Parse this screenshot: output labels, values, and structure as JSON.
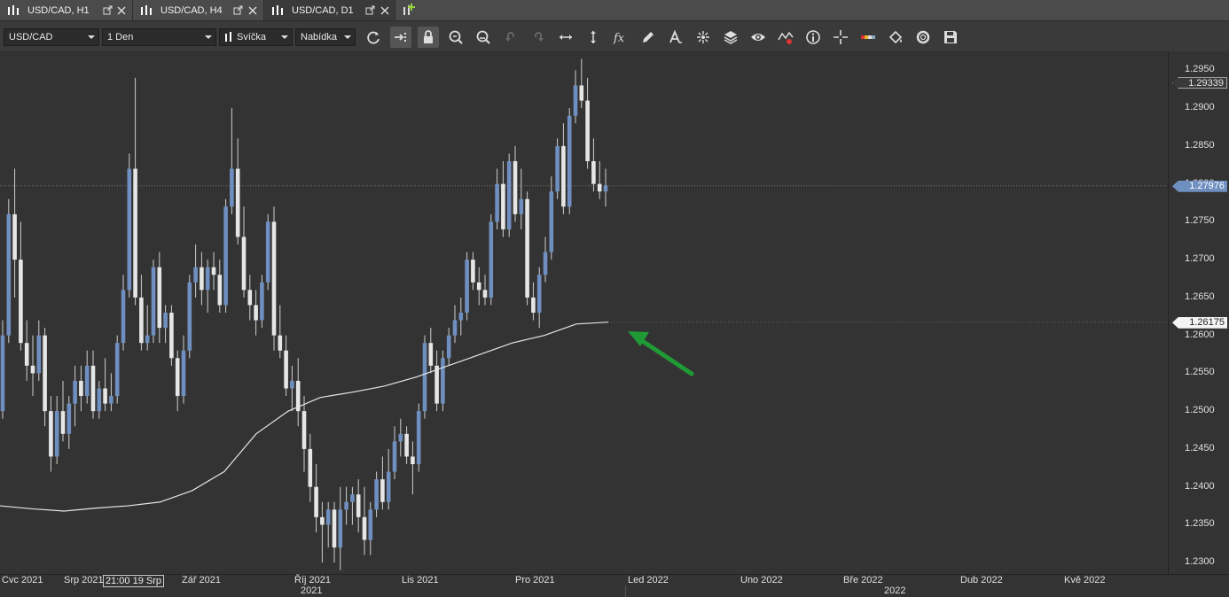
{
  "tabs": [
    {
      "label": "USD/CAD, H1",
      "active": false
    },
    {
      "label": "USD/CAD, H4",
      "active": false
    },
    {
      "label": "USD/CAD, D1",
      "active": true
    }
  ],
  "toolbar": {
    "symbol": "USD/CAD",
    "timeframe": "1 Den",
    "chart_type": "Svíčka",
    "price_side": "Nabídka",
    "tools": [
      "refresh-icon",
      "autoscroll-icon",
      "lock-icon",
      "zoom-in-icon",
      "zoom-out-icon",
      "undo-icon",
      "redo-icon",
      "horizontal-scale-icon",
      "vertical-scale-icon",
      "indicator-fx-icon",
      "pencil-icon",
      "text-icon",
      "objects-icon",
      "layers-icon",
      "eye-icon",
      "alerts-icon",
      "info-icon",
      "crosshair-icon",
      "color-icon",
      "paint-bucket-icon",
      "settings-icon",
      "save-icon"
    ]
  },
  "price_axis": {
    "ticks": [
      "1.2950",
      "1.2900",
      "1.2850",
      "1.2800",
      "1.2750",
      "1.2700",
      "1.2650",
      "1.2600",
      "1.2550",
      "1.2500",
      "1.2450",
      "1.2400",
      "1.2350",
      "1.2300"
    ],
    "labels": [
      {
        "value": "1.29339",
        "style": "outline"
      },
      {
        "value": "1.27976",
        "style": "blue"
      },
      {
        "value": "1.26175",
        "style": "white"
      }
    ]
  },
  "time_axis": {
    "months": [
      "Cvc 2021",
      "Srp 2021",
      "Zář 2021",
      "Říj 2021",
      "Lis 2021",
      "Pro 2021",
      "Led 2022",
      "Uno 2022",
      "Bře 2022",
      "Dub 2022",
      "Kvě 2022"
    ],
    "years": [
      "2021",
      "2022"
    ],
    "crosshair_time": "21:00 19 Srp"
  },
  "colors": {
    "background": "#333333",
    "bull": "#6f8fc0",
    "bear": "#e6e6e6",
    "ma": "#e6e6e6",
    "arrow": "#1f9a35"
  },
  "chart_data": {
    "type": "candlestick",
    "symbol": "USD/CAD",
    "timeframe": "D1",
    "ylim": [
      1.2285,
      1.2975
    ],
    "last_price": 1.27976,
    "marked_price": 1.29339,
    "ma_last": 1.26175,
    "candles": [
      [
        1.25,
        1.262,
        1.249,
        1.26
      ],
      [
        1.26,
        1.278,
        1.259,
        1.276
      ],
      [
        1.276,
        1.282,
        1.265,
        1.27
      ],
      [
        1.27,
        1.275,
        1.258,
        1.259
      ],
      [
        1.259,
        1.262,
        1.254,
        1.256
      ],
      [
        1.256,
        1.26,
        1.252,
        1.255
      ],
      [
        1.255,
        1.262,
        1.254,
        1.26
      ],
      [
        1.26,
        1.261,
        1.248,
        1.25
      ],
      [
        1.25,
        1.252,
        1.242,
        1.244
      ],
      [
        1.244,
        1.252,
        1.243,
        1.25
      ],
      [
        1.25,
        1.254,
        1.246,
        1.247
      ],
      [
        1.247,
        1.252,
        1.245,
        1.251
      ],
      [
        1.251,
        1.256,
        1.248,
        1.254
      ],
      [
        1.254,
        1.256,
        1.25,
        1.252
      ],
      [
        1.252,
        1.258,
        1.251,
        1.256
      ],
      [
        1.256,
        1.258,
        1.249,
        1.25
      ],
      [
        1.25,
        1.254,
        1.249,
        1.253
      ],
      [
        1.253,
        1.257,
        1.25,
        1.251
      ],
      [
        1.251,
        1.255,
        1.25,
        1.252
      ],
      [
        1.252,
        1.26,
        1.251,
        1.259
      ],
      [
        1.259,
        1.268,
        1.258,
        1.266
      ],
      [
        1.266,
        1.284,
        1.265,
        1.282
      ],
      [
        1.282,
        1.294,
        1.264,
        1.265
      ],
      [
        1.265,
        1.268,
        1.258,
        1.259
      ],
      [
        1.259,
        1.264,
        1.258,
        1.26
      ],
      [
        1.26,
        1.27,
        1.259,
        1.269
      ],
      [
        1.269,
        1.271,
        1.259,
        1.261
      ],
      [
        1.261,
        1.264,
        1.259,
        1.263
      ],
      [
        1.263,
        1.264,
        1.256,
        1.257
      ],
      [
        1.257,
        1.258,
        1.25,
        1.252
      ],
      [
        1.252,
        1.26,
        1.251,
        1.258
      ],
      [
        1.258,
        1.268,
        1.257,
        1.267
      ],
      [
        1.267,
        1.272,
        1.265,
        1.269
      ],
      [
        1.269,
        1.271,
        1.264,
        1.266
      ],
      [
        1.266,
        1.27,
        1.263,
        1.269
      ],
      [
        1.269,
        1.271,
        1.266,
        1.268
      ],
      [
        1.268,
        1.27,
        1.263,
        1.264
      ],
      [
        1.264,
        1.278,
        1.263,
        1.277
      ],
      [
        1.277,
        1.29,
        1.276,
        1.282
      ],
      [
        1.282,
        1.286,
        1.272,
        1.273
      ],
      [
        1.273,
        1.277,
        1.265,
        1.266
      ],
      [
        1.266,
        1.268,
        1.262,
        1.264
      ],
      [
        1.264,
        1.266,
        1.26,
        1.262
      ],
      [
        1.262,
        1.268,
        1.261,
        1.267
      ],
      [
        1.267,
        1.276,
        1.266,
        1.275
      ],
      [
        1.275,
        1.277,
        1.258,
        1.26
      ],
      [
        1.26,
        1.264,
        1.257,
        1.258
      ],
      [
        1.258,
        1.26,
        1.252,
        1.253
      ],
      [
        1.253,
        1.256,
        1.25,
        1.254
      ],
      [
        1.254,
        1.257,
        1.248,
        1.25
      ],
      [
        1.25,
        1.252,
        1.242,
        1.245
      ],
      [
        1.245,
        1.247,
        1.238,
        1.24
      ],
      [
        1.24,
        1.243,
        1.234,
        1.236
      ],
      [
        1.236,
        1.238,
        1.23,
        1.235
      ],
      [
        1.235,
        1.238,
        1.232,
        1.237
      ],
      [
        1.237,
        1.238,
        1.23,
        1.232
      ],
      [
        1.232,
        1.24,
        1.229,
        1.237
      ],
      [
        1.237,
        1.24,
        1.235,
        1.238
      ],
      [
        1.238,
        1.24,
        1.235,
        1.239
      ],
      [
        1.239,
        1.241,
        1.234,
        1.236
      ],
      [
        1.236,
        1.24,
        1.231,
        1.233
      ],
      [
        1.233,
        1.238,
        1.231,
        1.237
      ],
      [
        1.237,
        1.242,
        1.236,
        1.241
      ],
      [
        1.241,
        1.244,
        1.237,
        1.238
      ],
      [
        1.238,
        1.245,
        1.237,
        1.242
      ],
      [
        1.242,
        1.248,
        1.241,
        1.246
      ],
      [
        1.246,
        1.249,
        1.244,
        1.247
      ],
      [
        1.247,
        1.248,
        1.243,
        1.244
      ],
      [
        1.244,
        1.246,
        1.239,
        1.243
      ],
      [
        1.243,
        1.251,
        1.242,
        1.25
      ],
      [
        1.25,
        1.26,
        1.249,
        1.259
      ],
      [
        1.259,
        1.261,
        1.255,
        1.256
      ],
      [
        1.256,
        1.258,
        1.25,
        1.251
      ],
      [
        1.251,
        1.258,
        1.25,
        1.257
      ],
      [
        1.257,
        1.261,
        1.256,
        1.26
      ],
      [
        1.26,
        1.264,
        1.259,
        1.262
      ],
      [
        1.262,
        1.265,
        1.26,
        1.263
      ],
      [
        1.263,
        1.271,
        1.262,
        1.27
      ],
      [
        1.27,
        1.271,
        1.266,
        1.267
      ],
      [
        1.267,
        1.269,
        1.264,
        1.266
      ],
      [
        1.266,
        1.268,
        1.264,
        1.265
      ],
      [
        1.265,
        1.276,
        1.264,
        1.275
      ],
      [
        1.275,
        1.282,
        1.274,
        1.28
      ],
      [
        1.28,
        1.283,
        1.273,
        1.274
      ],
      [
        1.274,
        1.284,
        1.273,
        1.283
      ],
      [
        1.283,
        1.285,
        1.275,
        1.276
      ],
      [
        1.276,
        1.282,
        1.274,
        1.278
      ],
      [
        1.278,
        1.279,
        1.264,
        1.265
      ],
      [
        1.265,
        1.267,
        1.262,
        1.263
      ],
      [
        1.263,
        1.269,
        1.261,
        1.268
      ],
      [
        1.268,
        1.273,
        1.267,
        1.271
      ],
      [
        1.271,
        1.281,
        1.27,
        1.279
      ],
      [
        1.279,
        1.286,
        1.278,
        1.285
      ],
      [
        1.285,
        1.288,
        1.276,
        1.277
      ],
      [
        1.277,
        1.29,
        1.276,
        1.289
      ],
      [
        1.289,
        1.295,
        1.288,
        1.293
      ],
      [
        1.293,
        1.2965,
        1.29,
        1.291
      ],
      [
        1.291,
        1.294,
        1.282,
        1.283
      ],
      [
        1.283,
        1.286,
        1.279,
        1.28
      ],
      [
        1.28,
        1.283,
        1.278,
        1.279
      ],
      [
        1.279,
        1.282,
        1.277,
        1.2798
      ]
    ],
    "ma": [
      1.2375,
      1.2371,
      1.2368,
      1.2372,
      1.2375,
      1.238,
      1.2395,
      1.242,
      1.247,
      1.25,
      1.2518,
      1.2525,
      1.2533,
      1.2545,
      1.256,
      1.2575,
      1.259,
      1.26,
      1.2615,
      1.26175
    ]
  }
}
